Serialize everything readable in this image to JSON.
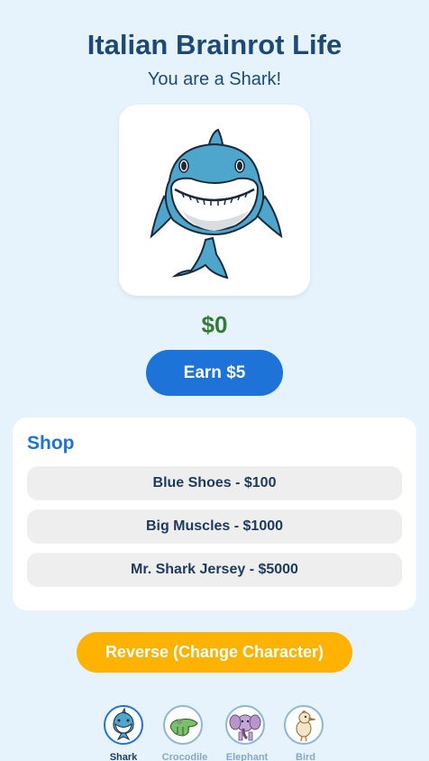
{
  "header": {
    "title": "Italian Brainrot Life",
    "subtitle": "You are a Shark!"
  },
  "character": {
    "name": "Shark",
    "image_icon": "shark-icon"
  },
  "balance": {
    "money": "$0"
  },
  "actions": {
    "earn_label": "Earn $5",
    "reverse_label": "Reverse (Change Character)"
  },
  "shop": {
    "title": "Shop",
    "items": [
      {
        "label": "Blue Shoes - $100"
      },
      {
        "label": "Big Muscles - $1000"
      },
      {
        "label": "Mr. Shark Jersey - $5000"
      }
    ]
  },
  "characters": [
    {
      "label": "Shark",
      "icon": "shark-icon",
      "selected": true
    },
    {
      "label": "Crocodile",
      "icon": "crocodile-icon",
      "selected": false
    },
    {
      "label": "Elephant",
      "icon": "elephant-icon",
      "selected": false
    },
    {
      "label": "Bird",
      "icon": "bird-icon",
      "selected": false
    }
  ],
  "colors": {
    "background": "#e6f3fd",
    "title": "#1d4a75",
    "money": "#2e7d32",
    "earn_button": "#1e73d8",
    "reverse_button": "#ffb300",
    "shop_item": "#eeeeee"
  }
}
